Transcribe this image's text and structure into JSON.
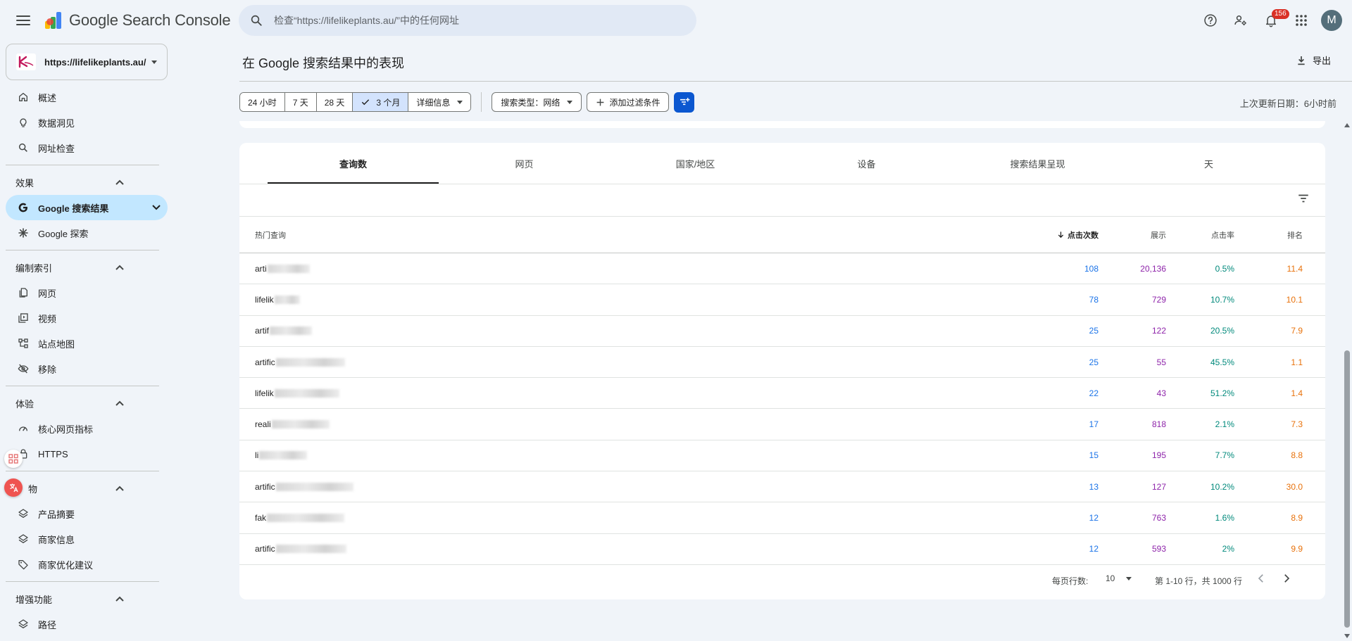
{
  "app": {
    "title": "Google Search Console",
    "search_placeholder": "检查“https://lifelikeplants.au/”中的任何网址",
    "notifications_count": "156",
    "avatar_letter": "M",
    "brand_colors": {
      "accent": "#0b57d0",
      "active_nav": "#c2e7ff",
      "selected_range": "#d3e3fd"
    }
  },
  "property": {
    "url": "https://lifelikeplants.au/"
  },
  "sidebar": {
    "items_top": [
      {
        "label": "概述",
        "icon": "home-icon"
      },
      {
        "label": "数据洞见",
        "icon": "lightbulb-icon"
      },
      {
        "label": "网址检查",
        "icon": "search-icon"
      }
    ],
    "sections": [
      {
        "title": "效果",
        "items": [
          {
            "label": "Google 搜索结果",
            "icon": "google-g-icon",
            "active": true
          },
          {
            "label": "Google 探索",
            "icon": "asterisk-icon"
          }
        ]
      },
      {
        "title": "编制索引",
        "items": [
          {
            "label": "网页",
            "icon": "pages-icon"
          },
          {
            "label": "视频",
            "icon": "video-icon"
          },
          {
            "label": "站点地图",
            "icon": "sitemap-icon"
          },
          {
            "label": "移除",
            "icon": "eye-off-icon"
          }
        ]
      },
      {
        "title": "体验",
        "items": [
          {
            "label": "核心网页指标",
            "icon": "gauge-icon"
          },
          {
            "label": "HTTPS",
            "icon": "lock-icon"
          }
        ]
      },
      {
        "title": "物",
        "items": [
          {
            "label": "产品摘要",
            "icon": "layers-icon"
          },
          {
            "label": "商家信息",
            "icon": "layers-icon"
          },
          {
            "label": "商家优化建议",
            "icon": "tag-icon"
          }
        ]
      },
      {
        "title": "增强功能",
        "items": [
          {
            "label": "路径",
            "icon": "layers-icon"
          }
        ]
      }
    ]
  },
  "header": {
    "title": "在 Google 搜索结果中的表现",
    "export_label": "导出",
    "last_updated": "上次更新日期：6小时前"
  },
  "filters": {
    "ranges": [
      "24 小时",
      "7 天",
      "28 天",
      "3 个月"
    ],
    "selected_range": "3 个月",
    "details_label": "详细信息",
    "search_type": "搜索类型：网络",
    "add_filter": "添加过滤条件"
  },
  "tabs": [
    "查询数",
    "网页",
    "国家/地区",
    "设备",
    "搜索结果呈现",
    "天"
  ],
  "active_tab": "查询数",
  "table": {
    "columns": {
      "query": "热门查询",
      "clicks": "点击次数",
      "impressions": "展示",
      "ctr": "点击率",
      "position": "排名"
    },
    "sorted_by": "clicks",
    "rows": [
      {
        "query": "arti",
        "clicks": "108",
        "impressions": "20,136",
        "ctr": "0.5%",
        "position": "11.4"
      },
      {
        "query": "lifelik",
        "clicks": "78",
        "impressions": "729",
        "ctr": "10.7%",
        "position": "10.1"
      },
      {
        "query": "artif",
        "clicks": "25",
        "impressions": "122",
        "ctr": "20.5%",
        "position": "7.9"
      },
      {
        "query": "artific",
        "clicks": "25",
        "impressions": "55",
        "ctr": "45.5%",
        "position": "1.1"
      },
      {
        "query": "lifelik",
        "clicks": "22",
        "impressions": "43",
        "ctr": "51.2%",
        "position": "1.4"
      },
      {
        "query": "reali",
        "clicks": "17",
        "impressions": "818",
        "ctr": "2.1%",
        "position": "7.3"
      },
      {
        "query": "li",
        "clicks": "15",
        "impressions": "195",
        "ctr": "7.7%",
        "position": "8.8"
      },
      {
        "query": "artific",
        "clicks": "13",
        "impressions": "127",
        "ctr": "10.2%",
        "position": "30.0"
      },
      {
        "query": "fak",
        "clicks": "12",
        "impressions": "763",
        "ctr": "1.6%",
        "position": "8.9"
      },
      {
        "query": "artific",
        "clicks": "12",
        "impressions": "593",
        "ctr": "2%",
        "position": "9.9"
      }
    ],
    "pagination": {
      "rows_per_page_label": "每页行数:",
      "rows_per_page": "10",
      "range": "第 1-10 行，共 1000 行"
    }
  }
}
